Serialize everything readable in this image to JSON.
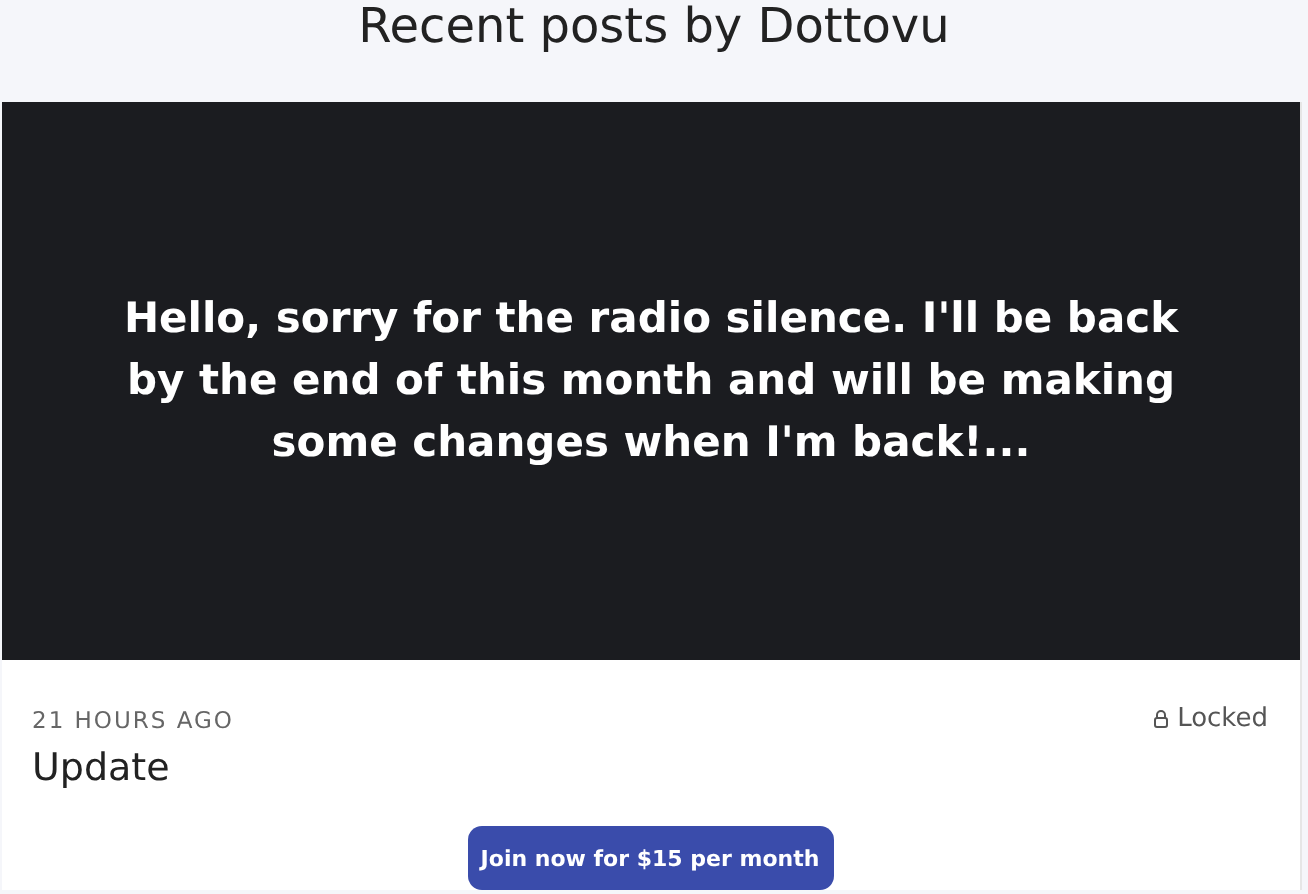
{
  "heading": "Recent posts by Dottovu",
  "post": {
    "preview": "Hello, sorry for the radio silence. I'll be back by the end of this month and will be making some changes when I'm back!...",
    "time": "21 HOURS AGO",
    "locked": true,
    "lock_label": "Locked",
    "title": "Update",
    "join_button": "Join now for $15 per month"
  }
}
